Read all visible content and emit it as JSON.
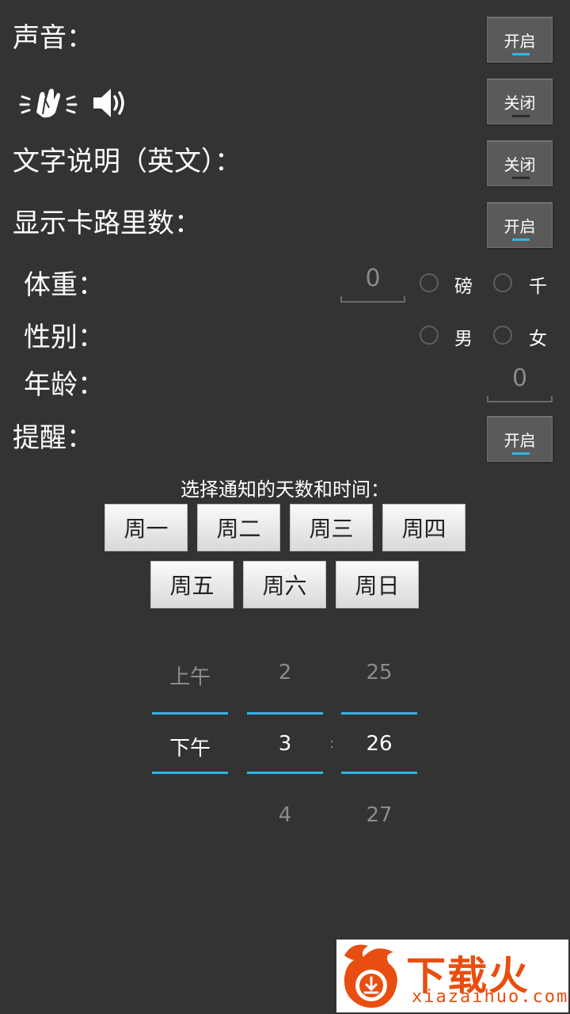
{
  "settings": {
    "sound_label": "声音：",
    "sound_toggle": "开启",
    "icon_toggle": "关闭",
    "text_desc_label": "文字说明（英文）：",
    "text_desc_toggle": "关闭",
    "calories_label": "显示卡路里数：",
    "calories_toggle": "开启"
  },
  "profile": {
    "weight_label": "体重：",
    "weight_value": "0",
    "unit_pound": "磅",
    "unit_kilo": "千",
    "gender_label": "性别：",
    "male": "男",
    "female": "女",
    "age_label": "年龄：",
    "age_value": "0"
  },
  "reminder": {
    "label": "提醒：",
    "toggle": "开启",
    "caption": "选择通知的天数和时间：",
    "days": [
      "周一",
      "周二",
      "周三",
      "周四",
      "周五",
      "周六",
      "周日"
    ]
  },
  "time_picker": {
    "ampm": {
      "above": "上午",
      "selected": "下午"
    },
    "hour": {
      "above": "2",
      "selected": "3",
      "below": "4"
    },
    "separator": ":",
    "minute": {
      "above": "25",
      "selected": "26",
      "below": "27"
    }
  },
  "watermark": {
    "brand": "下载火",
    "url": "xiazaihuo.com"
  },
  "colors": {
    "background": "#333333",
    "accent": "#33b5e5",
    "brand": "#e84e0f"
  }
}
